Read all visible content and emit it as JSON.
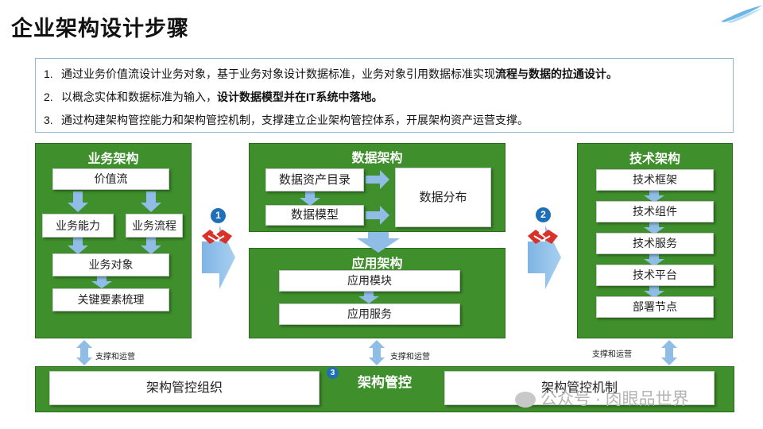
{
  "title": "企业架构设计步骤",
  "intro": {
    "lines": [
      {
        "num": "1.",
        "text": "通过业务价值流设计业务对象，基于业务对象设计数据标准，业务对象引用数据标准实现",
        "bold": "流程与数据的拉通设计。"
      },
      {
        "num": "2.",
        "text": "以概念实体和数据标准为输入，",
        "bold": "设计数据模型并在IT系统中落地。"
      },
      {
        "num": "3.",
        "text": "通过构建架构管控能力和架构管控机制，支撑建立企业架构管控体系，开展架构资产运营支撑。",
        "bold": ""
      }
    ]
  },
  "business": {
    "title": "业务架构",
    "value_stream": "价值流",
    "capability": "业务能力",
    "process": "业务流程",
    "object": "业务对象",
    "key_elements": "关键要素梳理"
  },
  "data": {
    "title": "数据架构",
    "catalog": "数据资产目录",
    "model": "数据模型",
    "distribution": "数据分布"
  },
  "application": {
    "title": "应用架构",
    "module": "应用模块",
    "service": "应用服务"
  },
  "tech": {
    "title": "技术架构",
    "items": [
      "技术框架",
      "技术组件",
      "技术服务",
      "技术平台",
      "部署节点"
    ]
  },
  "governance": {
    "title": "架构管控",
    "organization": "架构管控组织",
    "mechanism": "架构管控机制"
  },
  "support_label": "支撑和运营",
  "badges": [
    "1",
    "2",
    "3"
  ],
  "watermark": "公众号 · 肉眼品世界",
  "colors": {
    "panel_green": "#3f8f2c",
    "arrow_blue": "#8fbde6",
    "badge_blue": "#1f6fb8",
    "handshake_red": "#d9322b"
  }
}
